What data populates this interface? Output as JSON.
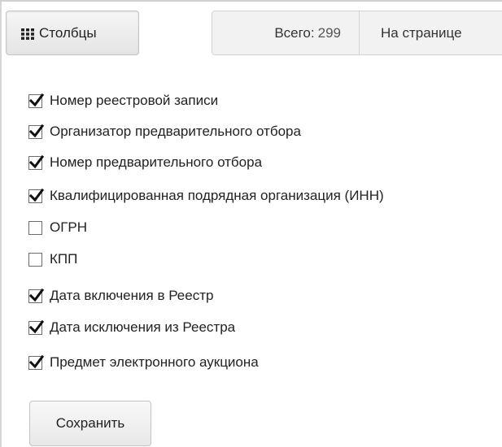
{
  "toolbar": {
    "columns_button": {
      "icon": "grid-icon",
      "label": "Столбцы"
    },
    "total_label": "Всего:",
    "total_value": "299",
    "per_page_label": "На странице"
  },
  "columns": [
    {
      "label": "Номер реестровой записи",
      "checked": true
    },
    {
      "label": "Организатор предварительного отбора",
      "checked": true
    },
    {
      "label": "Номер предварительного отбора",
      "checked": true
    },
    {
      "label": "Квалифицированная подрядная организация (ИНН)",
      "checked": true
    },
    {
      "label": "ОГРН",
      "checked": false
    },
    {
      "label": "КПП",
      "checked": false
    },
    {
      "label": "Дата включения в Реестр",
      "checked": true
    },
    {
      "label": "Дата исключения из Реестра",
      "checked": true
    },
    {
      "label": "Предмет электронного аукциона",
      "checked": true
    }
  ],
  "save_label": "Сохранить"
}
